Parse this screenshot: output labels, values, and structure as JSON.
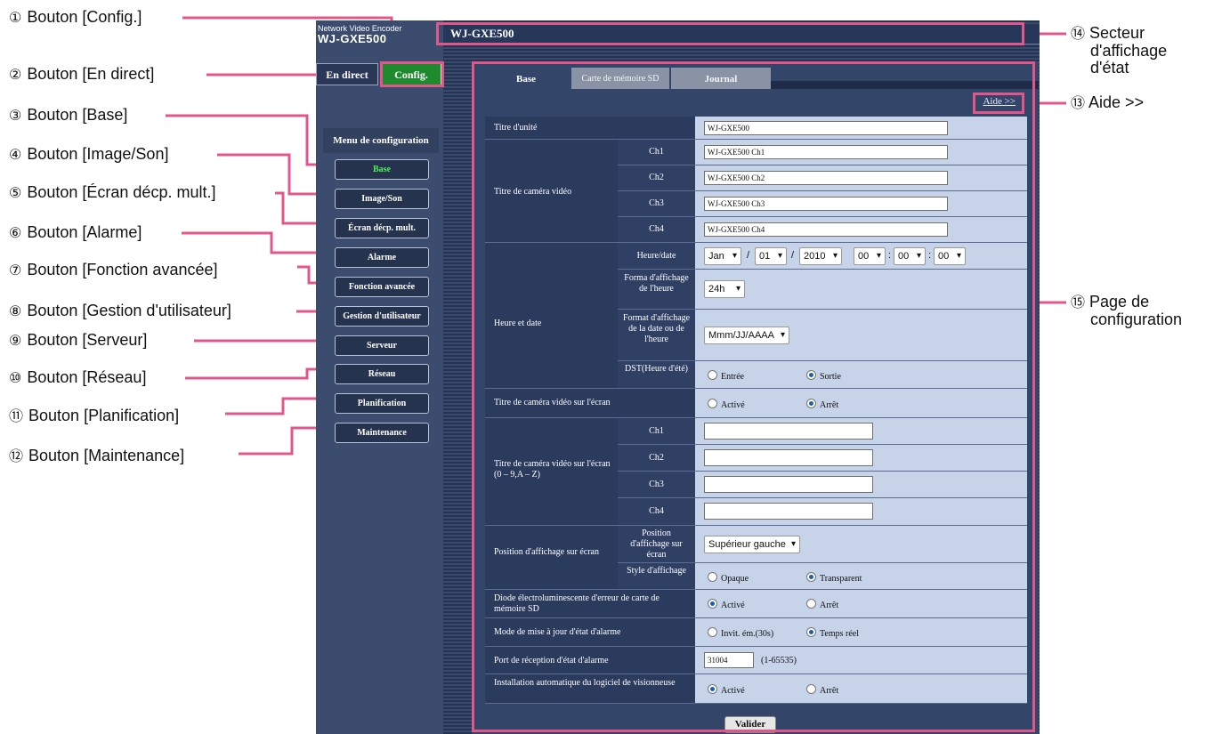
{
  "callouts_left": [
    {
      "num": "①",
      "label": "Bouton [Config.]"
    },
    {
      "num": "②",
      "label": "Bouton [En direct]"
    },
    {
      "num": "③",
      "label": "Bouton [Base]"
    },
    {
      "num": "④",
      "label": "Bouton [Image/Son]"
    },
    {
      "num": "⑤",
      "label": "Bouton [Écran décp. mult.]"
    },
    {
      "num": "⑥",
      "label": "Bouton [Alarme]"
    },
    {
      "num": "⑦",
      "label": "Bouton [Fonction avancée]"
    },
    {
      "num": "⑧",
      "label": "Bouton [Gestion d'utilisateur]"
    },
    {
      "num": "⑨",
      "label": "Bouton [Serveur]"
    },
    {
      "num": "⑩",
      "label": "Bouton [Réseau]"
    },
    {
      "num": "⑪",
      "label": "Bouton [Planification]"
    },
    {
      "num": "⑫",
      "label": "Bouton [Maintenance]"
    }
  ],
  "callouts_right": {
    "status": {
      "num": "⑭",
      "line1": "Secteur",
      "line2": "d'affichage",
      "line3": "d'état"
    },
    "help": {
      "num": "⑬",
      "label": "Aide >>"
    },
    "config": {
      "num": "⑮",
      "line1": "Page de",
      "line2": "configuration"
    }
  },
  "brand": {
    "line1": "Network Video Encoder",
    "line2": "WJ-GXE500"
  },
  "top_buttons": {
    "live": "En direct",
    "config": "Config."
  },
  "menu": {
    "title": "Menu de configuration",
    "items": [
      "Base",
      "Image/Son",
      "Écran décp. mult.",
      "Alarme",
      "Fonction avancée",
      "Gestion d'utilisateur",
      "Serveur",
      "Réseau",
      "Planification",
      "Maintenance"
    ],
    "active_index": 0
  },
  "header": {
    "title": "WJ-GXE500"
  },
  "tabs": [
    "Base",
    "Carte de mémoire SD",
    "Journal"
  ],
  "help_link": "Aide >>",
  "form": {
    "unit_title": {
      "label": "Titre d'unité",
      "value": "WJ-GXE500"
    },
    "camera_title": {
      "label": "Titre de caméra vidéo",
      "channels": [
        {
          "ch": "Ch1",
          "value": "WJ-GXE500 Ch1"
        },
        {
          "ch": "Ch2",
          "value": "WJ-GXE500 Ch2"
        },
        {
          "ch": "Ch3",
          "value": "WJ-GXE500 Ch3"
        },
        {
          "ch": "Ch4",
          "value": "WJ-GXE500 Ch4"
        }
      ]
    },
    "datetime": {
      "label": "Heure et date",
      "date_label": "Heure/date",
      "month": "Jan",
      "day": "01",
      "year": "2010",
      "hour": "00",
      "minute": "00",
      "second": "00",
      "sep_slash": "/",
      "sep_colon": ":",
      "time_format_label": "Forma d'affichage de l'heure",
      "time_format": "24h",
      "date_format_label": "Format d'affichage de la date ou de l'heure",
      "date_format": "Mmm/JJ/AAAA",
      "dst_label": "DST(Heure d'été)",
      "dst_on": "Entrée",
      "dst_off": "Sortie",
      "dst_selected": "Sortie"
    },
    "osd_enable": {
      "label": "Titre de caméra vidéo sur l'écran",
      "on": "Activé",
      "off": "Arrêt",
      "selected": "Arrêt"
    },
    "osd_text": {
      "label": "Titre de caméra vidéo sur l'écran (0 – 9,A – Z)",
      "channels": [
        {
          "ch": "Ch1",
          "value": ""
        },
        {
          "ch": "Ch2",
          "value": ""
        },
        {
          "ch": "Ch3",
          "value": ""
        },
        {
          "ch": "Ch4",
          "value": ""
        }
      ]
    },
    "osd_position": {
      "label": "Position d'affichage sur écran",
      "pos_label": "Position d'affichage sur écran",
      "pos_value": "Supérieur gauche",
      "style_label": "Style d'affichage",
      "opaque": "Opaque",
      "transparent": "Transparent",
      "selected": "Transparent"
    },
    "sd_led": {
      "label": "Diode électroluminescente d'erreur de carte de mémoire SD",
      "on": "Activé",
      "off": "Arrêt",
      "selected": "Activé"
    },
    "alarm_mode": {
      "label": "Mode de mise à jour d'état d'alarme",
      "opt1": "Invit. ém.(30s)",
      "opt2": "Temps réel",
      "selected": "Temps réel"
    },
    "alarm_port": {
      "label": "Port de réception d'état d'alarme",
      "value": "31004",
      "range": "(1-65535)"
    },
    "viewer_install": {
      "label": "Installation automatique du logiciel de visionneuse",
      "on": "Activé",
      "off": "Arrêt",
      "selected": "Activé"
    },
    "submit_label": "Valider"
  },
  "colors": {
    "highlight": "#e2578b",
    "config_active": "#1e8a2e",
    "active_text": "#4df05a"
  }
}
